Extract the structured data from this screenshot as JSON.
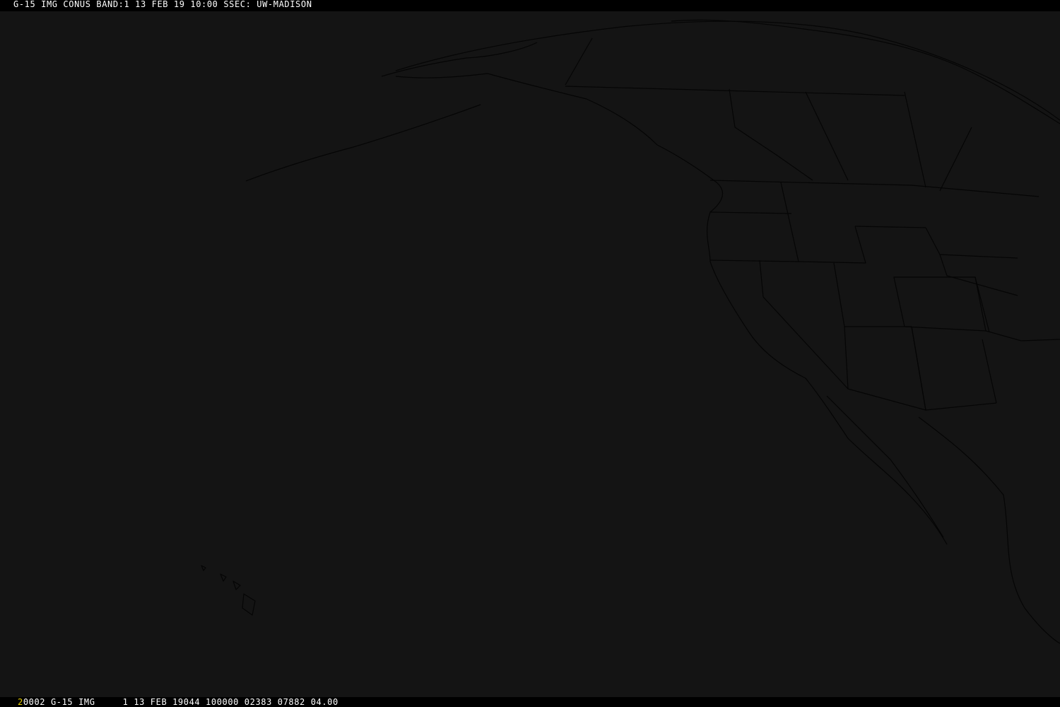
{
  "header": {
    "text": "G-15 IMG CONUS BAND:1 13 FEB 19 10:00 SSEC: UW-MADISON"
  },
  "footer": {
    "frame_number": "2",
    "text": "0002 G-15 IMG     1 13 FEB 19044 100000 02383 07882 04.00"
  },
  "colors": {
    "background": "#000000",
    "image": "#141414",
    "outline": "#050505",
    "header_text": "#ffffff",
    "frame_number": "#e8d000"
  }
}
